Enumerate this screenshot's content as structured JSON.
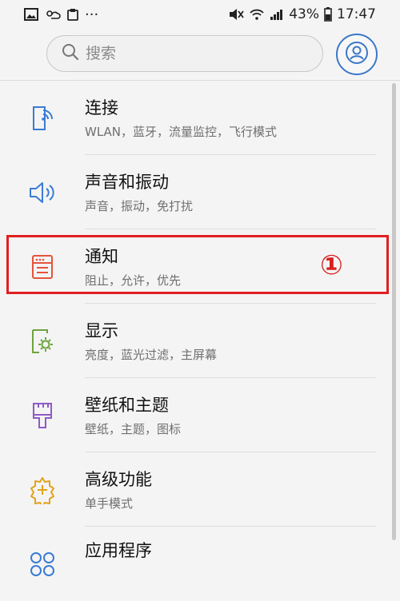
{
  "status_bar": {
    "battery_percent": "43%",
    "time": "17:47",
    "more_label": "···"
  },
  "search": {
    "placeholder": "搜索"
  },
  "colors": {
    "connect": "#3a7bd5",
    "sound": "#3a7bd5",
    "notify": "#e5533d",
    "display": "#6ea43c",
    "wallpaper": "#8e5cc4",
    "advanced": "#e2a21d",
    "apps": "#3a7bd5",
    "highlight": "#e02020",
    "avatar": "#3b78c7"
  },
  "settings": [
    {
      "title": "连接",
      "subtitle": "WLAN，蓝牙，流量监控，飞行模式",
      "icon": "connections-icon"
    },
    {
      "title": "声音和振动",
      "subtitle": "声音，振动，免打扰",
      "icon": "sound-icon"
    },
    {
      "title": "通知",
      "subtitle": "阻止，允许，优先",
      "icon": "notifications-icon"
    },
    {
      "title": "显示",
      "subtitle": "亮度，蓝光过滤，主屏幕",
      "icon": "display-icon"
    },
    {
      "title": "壁纸和主题",
      "subtitle": "壁纸，主题，图标",
      "icon": "wallpaper-icon"
    },
    {
      "title": "高级功能",
      "subtitle": "单手模式",
      "icon": "advanced-icon"
    },
    {
      "title": "应用程序",
      "subtitle": "",
      "icon": "apps-icon"
    }
  ],
  "annotation": {
    "step_marker": "①"
  }
}
